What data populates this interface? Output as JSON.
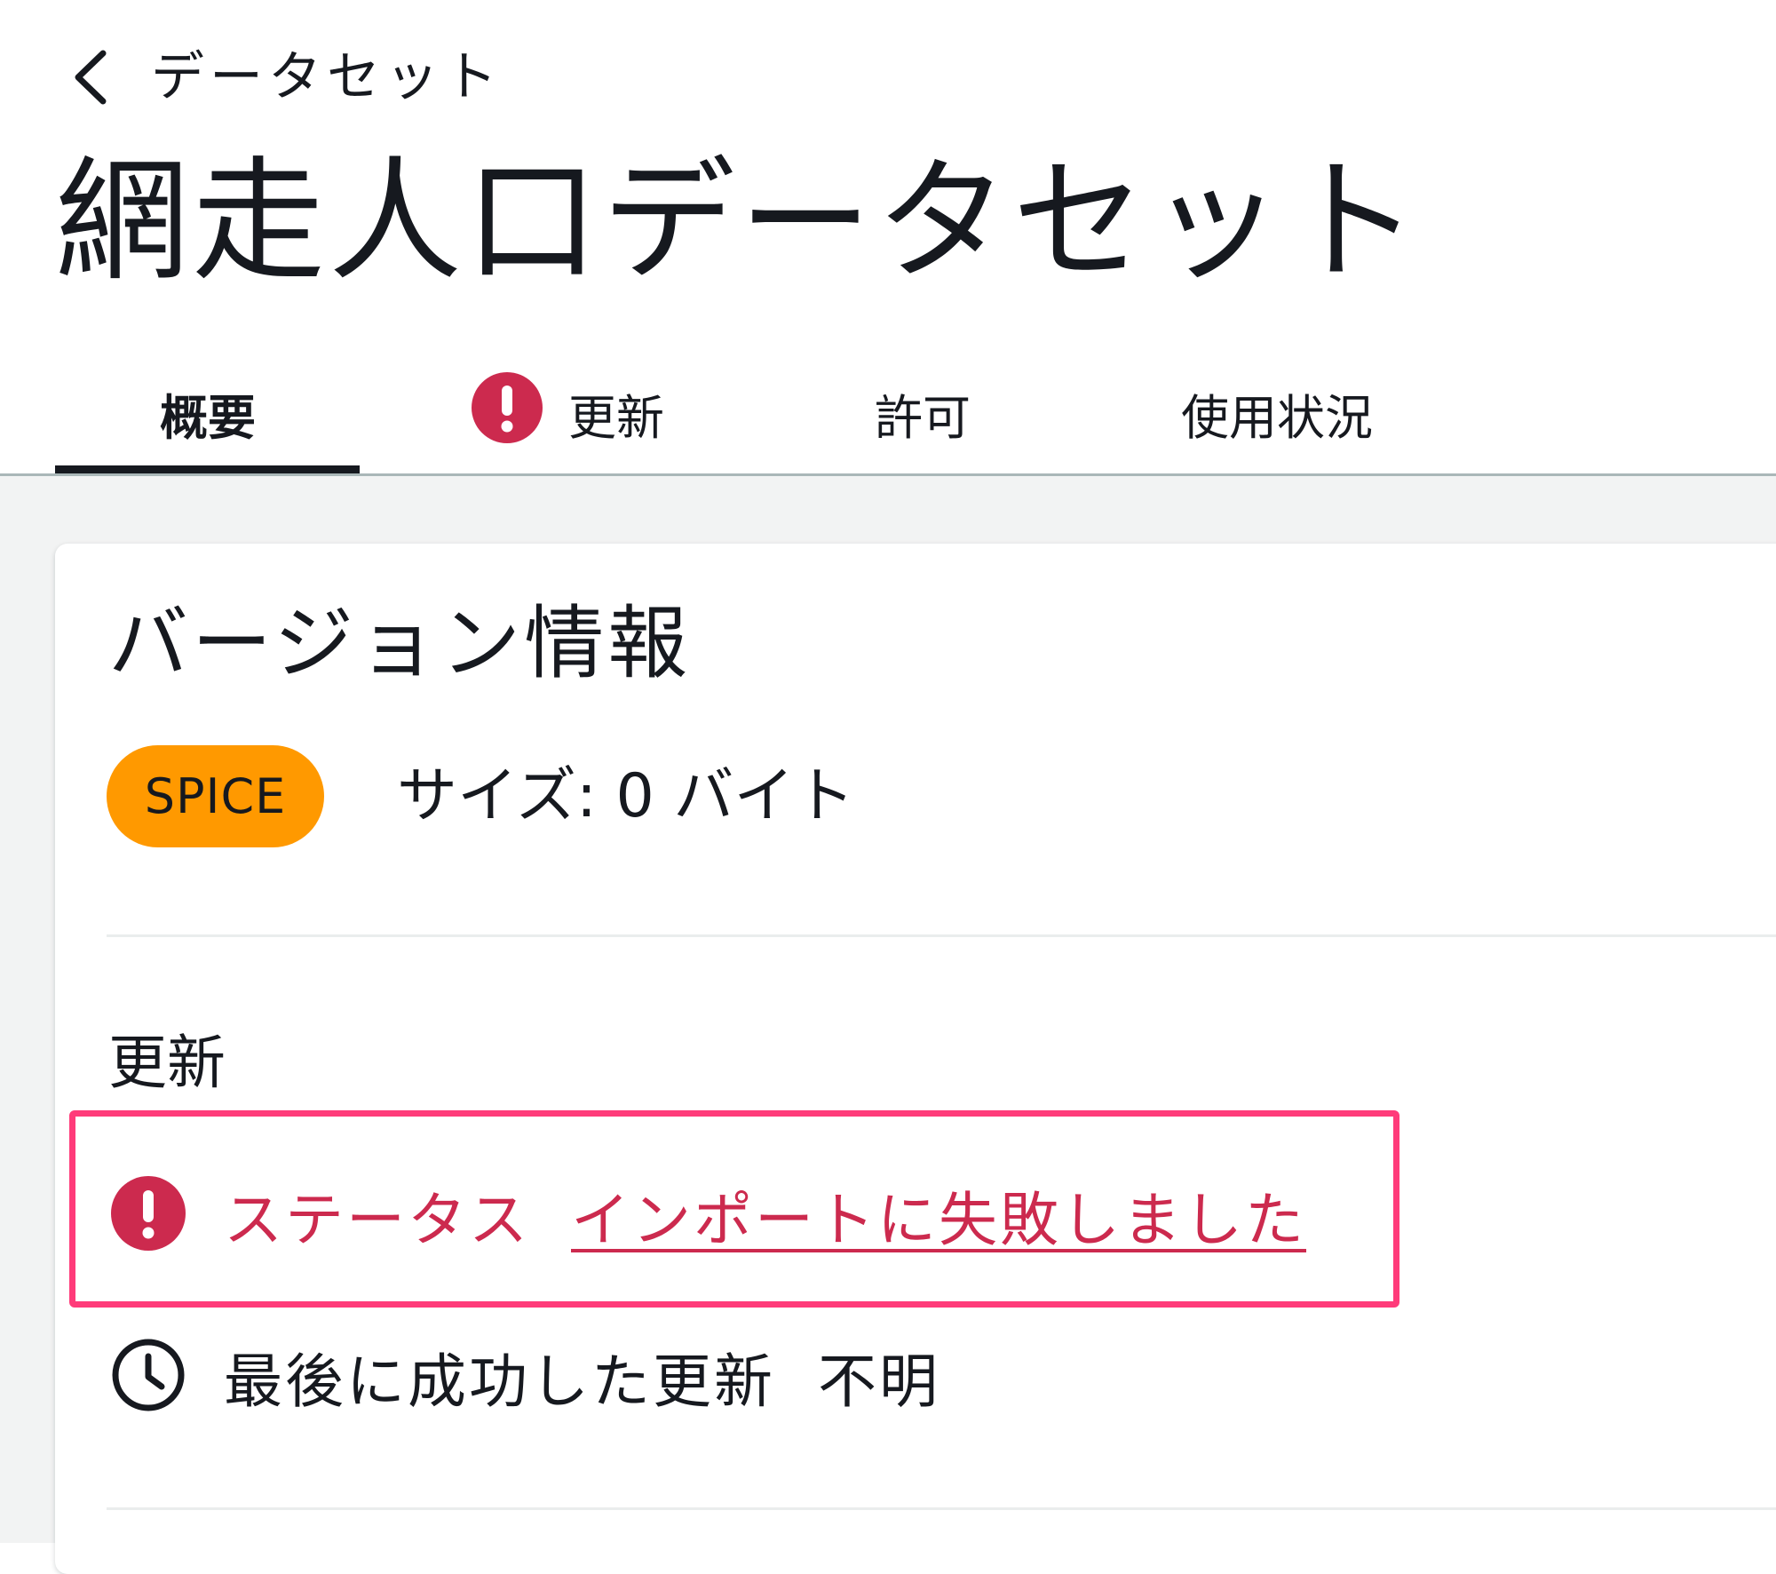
{
  "breadcrumb": {
    "back_label": "データセット"
  },
  "page": {
    "title": "網走人口データセット"
  },
  "tabs": [
    {
      "label": "概要",
      "active": true
    },
    {
      "label": "更新",
      "warning": true
    },
    {
      "label": "許可"
    },
    {
      "label": "使用状況"
    }
  ],
  "card": {
    "title": "バージョン情報",
    "badge": "SPICE",
    "size_text": "サイズ: 0 バイト",
    "refresh": {
      "section_label": "更新",
      "status_label": "ステータス",
      "status_value": "インポートに失敗しました",
      "last_success_label": "最後に成功した更新",
      "last_success_value": "不明"
    }
  },
  "colors": {
    "error": "#cc2a4e",
    "badge": "#ff9900",
    "highlight": "#ff3b7a"
  }
}
